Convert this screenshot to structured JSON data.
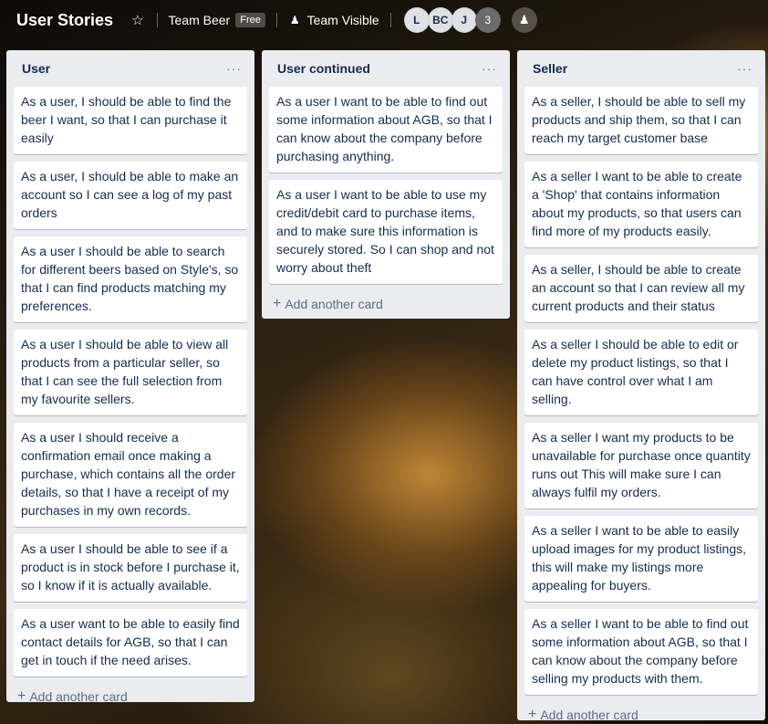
{
  "header": {
    "board_title": "User Stories",
    "team_name": "Team Beer",
    "team_badge": "Free",
    "visibility": "Team Visible",
    "members": [
      "L",
      "BC",
      "J"
    ],
    "extra_members": "3"
  },
  "lists": [
    {
      "title": "User",
      "cards": [
        "As a user, I should be able to find the beer I want, so that I can purchase it easily",
        "As a user, I should be able to make an account so I can see a log of my past orders",
        "As a user I should be able to search for different beers based on Style's, so that I can find products matching my preferences.",
        "As a user I should be able to view all products from a particular seller, so that I can see the full selection from my favourite sellers.",
        "As a user I should receive a confirmation email once making a purchase, which contains all the order details, so that I have a receipt of my purchases in my own records.",
        "As a user I should be able to see if a product is in stock before I purchase it, so I know if it is actually available.",
        "As a user want to be able to easily find contact details for AGB, so that I can get in touch if the need arises."
      ],
      "add_label": "Add another card"
    },
    {
      "title": "User continued",
      "cards": [
        "As a user I want to be able to find out some information about AGB, so that I can know about the company before purchasing anything.",
        "As a user I want to be able to use my credit/debit card to purchase items, and to make sure this information is securely stored. So I can shop and not worry about theft"
      ],
      "add_label": "Add another card"
    },
    {
      "title": "Seller",
      "cards": [
        "As a seller, I should be able to sell my products and ship them, so that I can reach my target customer base",
        "As a seller I want to be able to create a 'Shop' that contains information about my products, so that users can find more of my products easily.",
        "As a seller, I should be able to create an account so that I can review all my current products and their status",
        "As a seller I should be able to edit or delete my product listings, so that I can have control over what I am selling.",
        "As a seller I want my products to be unavailable for purchase once quantity runs out This will make sure I can always fulfil my orders.",
        "As a seller I want to be able to easily upload images for my product listings, this will make my listings more appealing for buyers.",
        "As a seller I want to be able to find out some information about AGB, so that I can know about the company before selling my products with them."
      ],
      "add_label": "Add another card"
    }
  ]
}
